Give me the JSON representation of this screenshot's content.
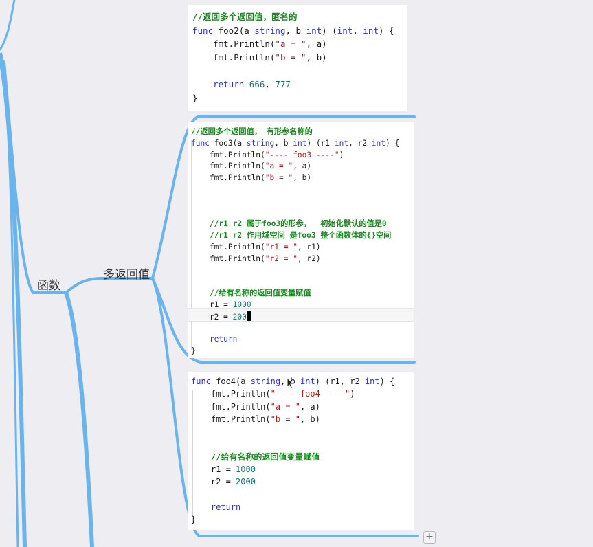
{
  "mindmap": {
    "node_main": "函数",
    "node_sub": "多返回值"
  },
  "colors": {
    "branch": "#6ab4ee",
    "background": "#eeedf2"
  },
  "cards": {
    "foo2": {
      "l1": "//返回多个返回值，匿名的",
      "l2a": "func",
      "l2b": " foo2(a ",
      "l2c": "string",
      "l2d": ", b ",
      "l2e": "int",
      "l2f": ") (",
      "l2g": "int",
      "l2h": ", ",
      "l2i": "int",
      "l2j": ") {",
      "l3a": "    fmt.Println(",
      "l3b": "\"a = \"",
      "l3c": ", a)",
      "l4a": "    fmt.Println(",
      "l4b": "\"b = \"",
      "l4c": ", b)",
      "l5": "",
      "l6a": "    ",
      "l6b": "return",
      "l6c": " ",
      "l6d": "666",
      "l6e": ", ",
      "l6f": "777",
      "l7": "}"
    },
    "foo3": {
      "l1": "//返回多个返回值， 有形参名称的",
      "l2a": "func",
      "l2b": " foo3(a ",
      "l2c": "string",
      "l2d": ", b ",
      "l2e": "int",
      "l2f": ") (r1 ",
      "l2g": "int",
      "l2h": ", r2 ",
      "l2i": "int",
      "l2j": ") {",
      "l3a": "    fmt.Println(",
      "l3b": "\"---- foo3 ----\"",
      "l3c": ")",
      "l4a": "    fmt.Println(",
      "l4b": "\"a = \"",
      "l4c": ", a)",
      "l5a": "    fmt.Println(",
      "l5b": "\"b = \"",
      "l5c": ", b)",
      "l9a": "    ",
      "l9b": "//r1 r2 属于foo3的形参，  初始化默认的值是0",
      "l10a": "    ",
      "l10b": "//r1 r2 作用域空间 是foo3 整个函数体的{}空间",
      "l11a": "    fmt.Println(",
      "l11b": "\"r1 = \"",
      "l11c": ", r1)",
      "l12a": "    fmt.Println(",
      "l12b": "\"r2 = \"",
      "l12c": ", r2)",
      "l15a": "    ",
      "l15b": "//给有名称的返回值变量赋值",
      "l16a": "    r1 = ",
      "l16b": "1000",
      "l17a": "    r2 = ",
      "l17b": "200",
      "l19a": "    ",
      "l19b": "return",
      "l20": "}"
    },
    "foo4": {
      "l1a": "func",
      "l1b": " foo4(a ",
      "l1c": "string",
      "l1d": ", b ",
      "l1e": "int",
      "l1f": ") (r1, r2 ",
      "l1g": "int",
      "l1h": ") {",
      "l2a": "    fmt.Println(",
      "l2b": "\"---- foo4 ----\"",
      "l2c": ")",
      "l3a": "    fmt.Println(",
      "l3b": "\"a = \"",
      "l3c": ", a)",
      "l4a": "    ",
      "l4b": "fmt",
      "l4c": ".Println(",
      "l4d": "\"b = \"",
      "l4e": ", b)",
      "l7a": "    ",
      "l7b": "//给有名称的返回值变量赋值",
      "l8a": "    r1 = ",
      "l8b": "1000",
      "l9a": "    r2 = ",
      "l9b": "2000",
      "l11a": "    ",
      "l11b": "return",
      "l12": "}"
    }
  },
  "controls": {
    "add_symbol": "+"
  }
}
